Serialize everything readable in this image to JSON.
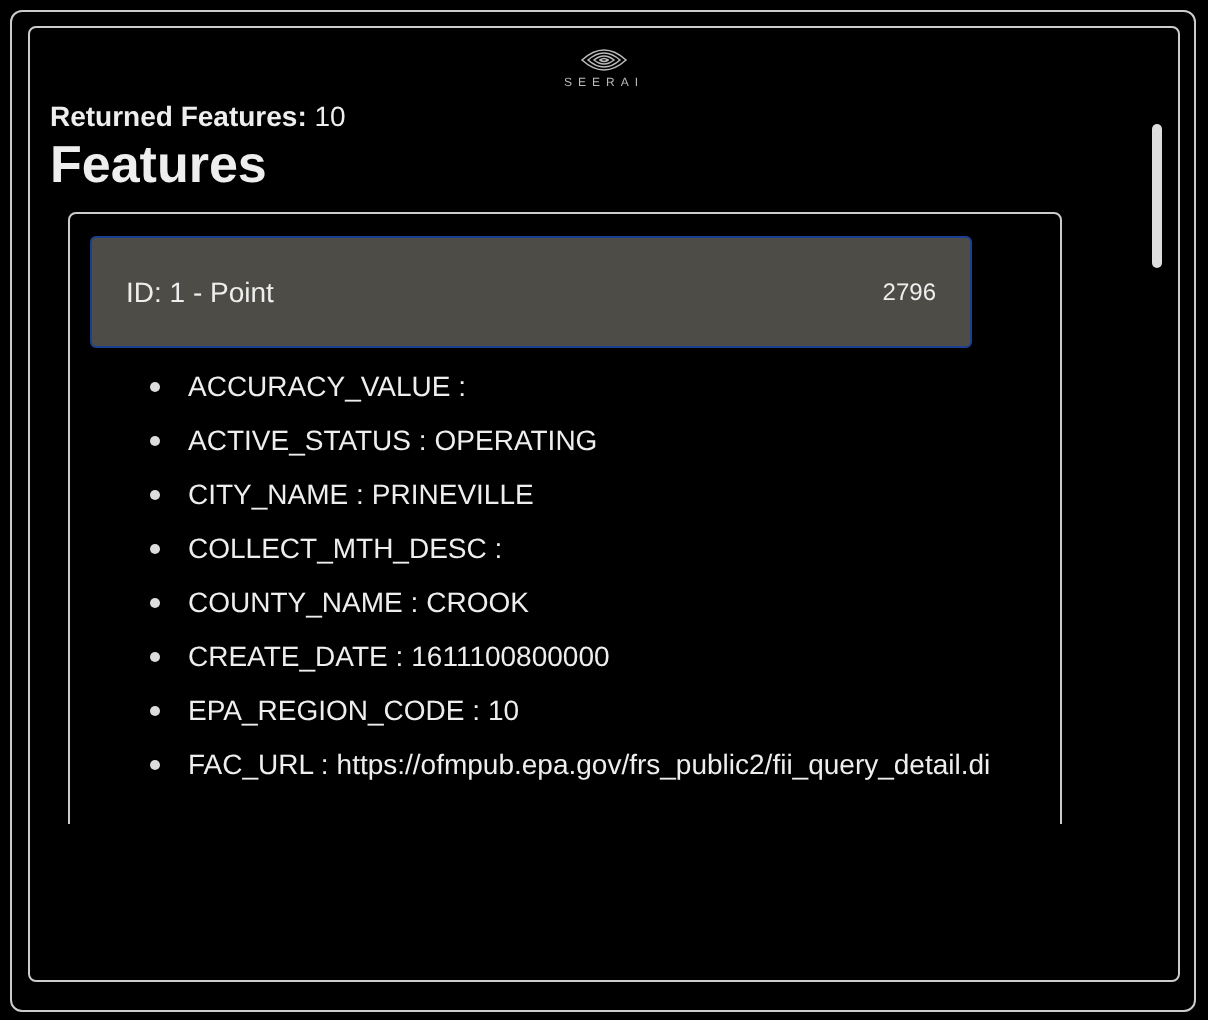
{
  "logo": {
    "text": "SEERAI"
  },
  "returned": {
    "label": "Returned Features:",
    "value": "10"
  },
  "heading": "Features",
  "feature": {
    "title": "ID: 1 - Point",
    "count": "2796",
    "selected": true
  },
  "properties": [
    {
      "key": "ACCURACY_VALUE :"
    },
    {
      "key": "ACTIVE_STATUS :",
      "value": "OPERATING"
    },
    {
      "key": "CITY_NAME :",
      "value": "PRINEVILLE"
    },
    {
      "key": "COLLECT_MTH_DESC :"
    },
    {
      "key": "COUNTY_NAME :",
      "value": "CROOK"
    },
    {
      "key": "CREATE_DATE :",
      "value": "1611100800000"
    },
    {
      "key": "EPA_REGION_CODE :",
      "value": "10"
    },
    {
      "key": "FAC_URL :",
      "value": "https://ofmpub.epa.gov/frs_public2/fii_query_detail.di"
    }
  ]
}
